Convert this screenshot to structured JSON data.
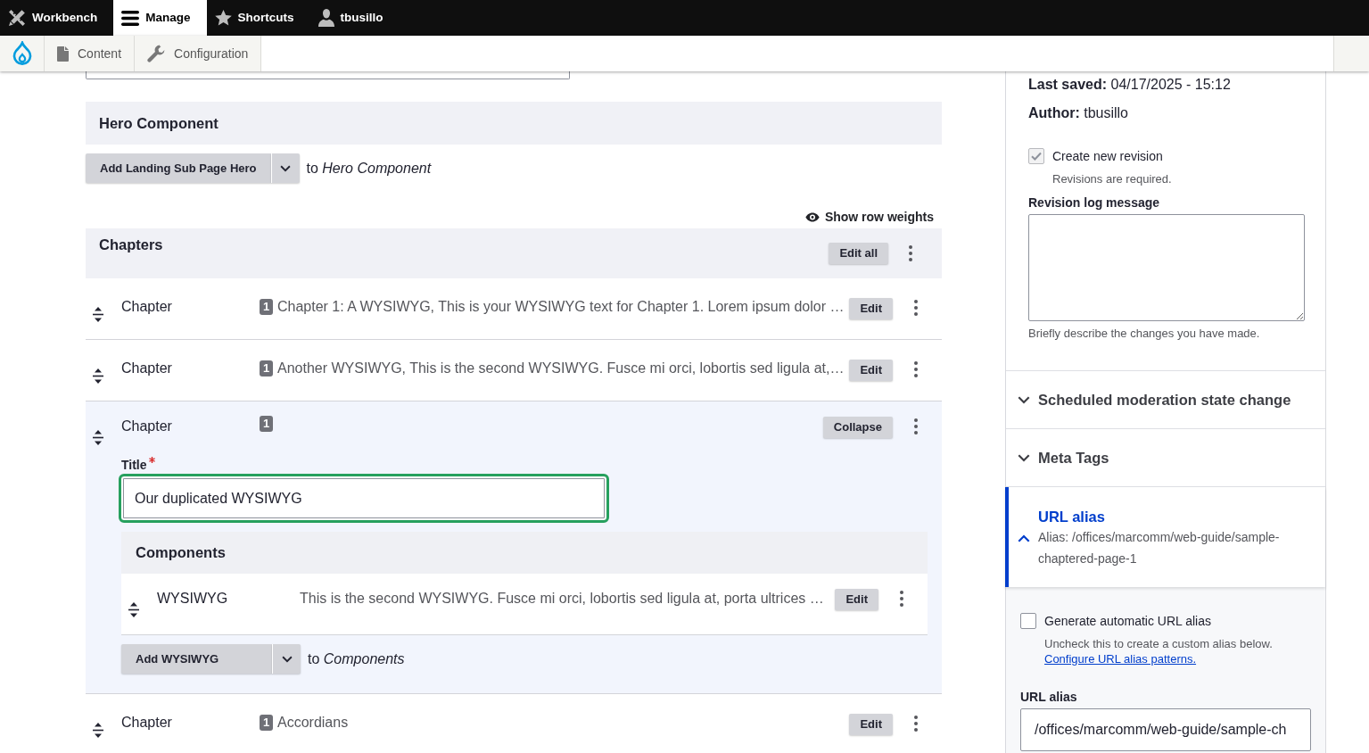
{
  "toolbar": {
    "items": [
      {
        "label": "Workbench",
        "selected": false
      },
      {
        "label": "Manage",
        "selected": true
      },
      {
        "label": "Shortcuts",
        "selected": false
      },
      {
        "label": "tbusillo",
        "selected": false
      }
    ]
  },
  "tray": {
    "items": [
      {
        "label": "Content"
      },
      {
        "label": "Configuration"
      }
    ]
  },
  "hero": {
    "title": "Hero Component",
    "add_button": "Add Landing Sub Page Hero",
    "target": "to *Hero Component*"
  },
  "show_row_weights": "Show row weights",
  "chapters": {
    "title": "Chapters",
    "edit_all": "Edit all",
    "rows": [
      {
        "label": "Chapter",
        "badge": "1",
        "summary": "Chapter 1: A WYSIWYG, This is your WYSIWYG text for Chapter 1. Lorem ipsum dolor …",
        "button": "Edit",
        "expanded": false
      },
      {
        "label": "Chapter",
        "badge": "1",
        "summary": "Another WYSIWYG, This is the second WYSIWYG. Fusce mi orci, lobortis sed ligula at,…",
        "button": "Edit",
        "expanded": false
      },
      {
        "label": "Chapter",
        "badge": "1",
        "button": "Collapse",
        "expanded": true,
        "title_field": {
          "label": "Title",
          "required": true,
          "value": "Our duplicated WYSIWYG",
          "focused": true
        },
        "components": {
          "title": "Components",
          "rows": [
            {
              "label": "WYSIWYG",
              "summary": "This is the second WYSIWYG. Fusce mi orci, lobortis sed ligula at, porta ultrices …",
              "button": "Edit"
            }
          ],
          "add_button": "Add WYSIWYG",
          "target": "to *Components*"
        }
      },
      {
        "label": "Chapter",
        "badge": "1",
        "summary": "Accordians",
        "button": "Edit",
        "expanded": false
      }
    ]
  },
  "sidebar": {
    "last_saved": "**Last saved:** 04/17/2025 - 15:12",
    "author": "**Author:** tbusillo",
    "new_revision": {
      "label": "Create new revision",
      "checked": true,
      "disabled": true,
      "description": "Revisions are required."
    },
    "revision_log": {
      "label": "Revision log message",
      "description": "Briefly describe the changes you have made."
    },
    "sections": [
      {
        "title": "Scheduled moderation state change",
        "expanded": false
      },
      {
        "title": "Meta Tags",
        "expanded": false
      },
      {
        "title": "URL alias",
        "expanded": true,
        "summary": "Alias: /offices/marcomm/web-guide/sample-chaptered-page-1",
        "auto_alias": {
          "label": "Generate automatic URL alias",
          "checked": false,
          "description": "Uncheck this to create a custom alias below.",
          "link": "Configure URL alias patterns."
        },
        "alias_field": {
          "label": "URL alias",
          "value": "/offices/marcomm/web-guide/sample-ch"
        }
      }
    ]
  }
}
